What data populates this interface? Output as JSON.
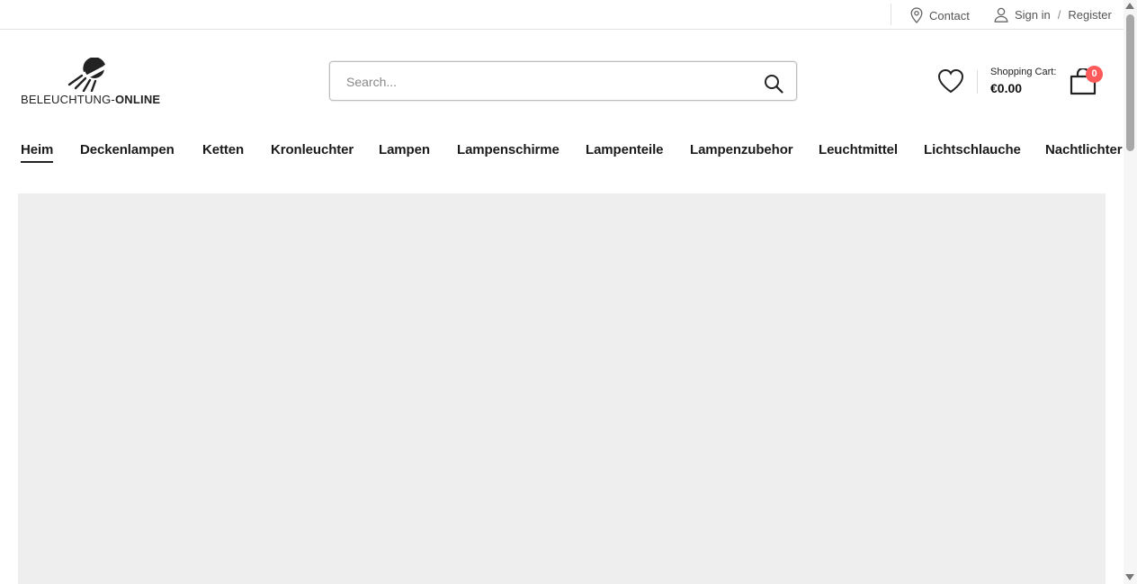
{
  "topbar": {
    "contact_label": "Contact",
    "signin_label": "Sign in",
    "separator": "/",
    "register_label": "Register"
  },
  "logo": {
    "text_light": "BELEUCHTUNG-",
    "text_bold": "ONLINE"
  },
  "search": {
    "placeholder": "Search..."
  },
  "cart": {
    "label": "Shopping Cart:",
    "total": "€0.00",
    "count": "0",
    "badge_color": "#ff5a5a"
  },
  "nav": {
    "items": [
      {
        "label": "Heim",
        "active": true
      },
      {
        "label": "Deckenlampen"
      },
      {
        "label": "Ketten"
      },
      {
        "label": "Kronleuchter"
      },
      {
        "label": "Lampen"
      },
      {
        "label": "Lampenschirme"
      },
      {
        "label": "Lampenteile"
      },
      {
        "label": "Lampenzubehor"
      },
      {
        "label": "Leuchtmittel"
      },
      {
        "label": "Lichtschlauche"
      },
      {
        "label": "Nachtlichter"
      }
    ]
  },
  "icons": {
    "contact": "location-pin-icon",
    "account": "user-icon",
    "search": "search-icon",
    "wishlist": "heart-icon",
    "cart": "shopping-bag-icon"
  }
}
